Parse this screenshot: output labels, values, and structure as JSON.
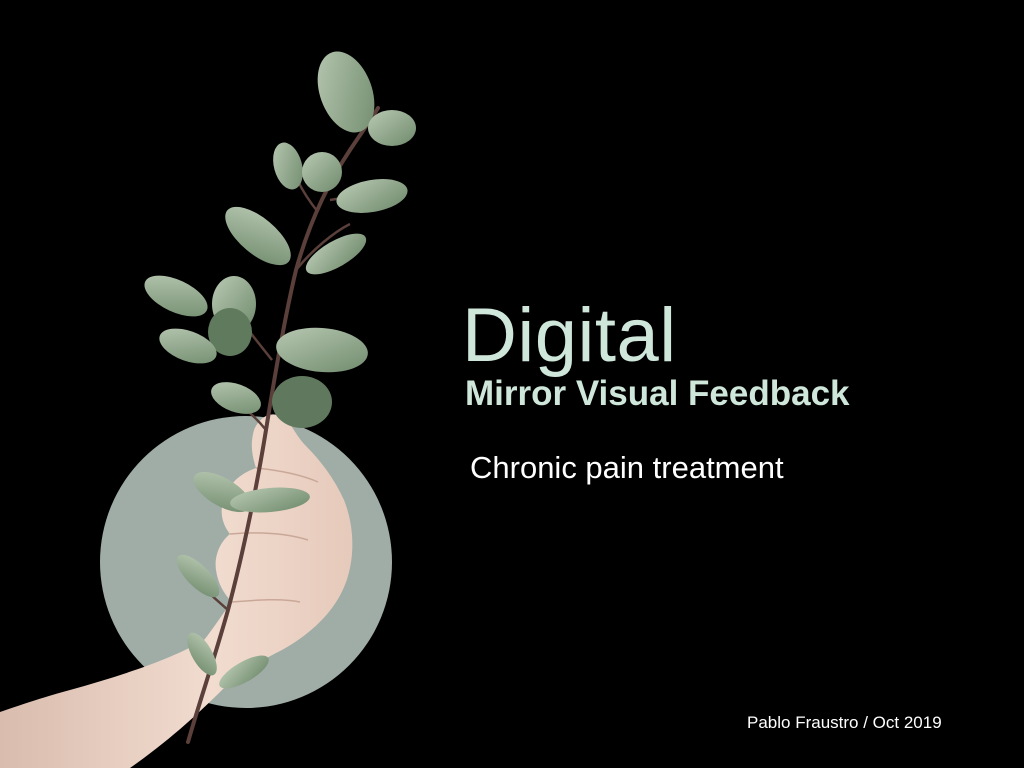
{
  "slide": {
    "title": "Digital",
    "subtitle": "Mirror Visual Feedback",
    "tagline": "Chronic pain treatment",
    "author_line": "Pablo Fraustro / Oct 2019"
  },
  "colors": {
    "background": "#000000",
    "title_color": "#cfe7db",
    "text_color": "#ffffff",
    "circle_color": "#9fada6",
    "leaf_color": "#8fa88e",
    "skin_color": "#ecd2c4"
  },
  "images": {
    "illustration": "hand-holding-eucalyptus-branch"
  }
}
